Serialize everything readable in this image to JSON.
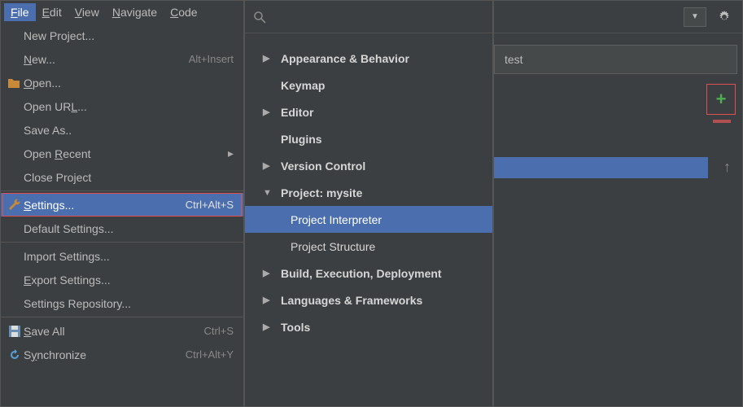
{
  "menubar": {
    "items": [
      {
        "label": "File",
        "u": "F"
      },
      {
        "label": "Edit",
        "u": "E"
      },
      {
        "label": "View",
        "u": "V"
      },
      {
        "label": "Navigate",
        "u": "N"
      },
      {
        "label": "Code",
        "u": "C"
      }
    ]
  },
  "file_menu": {
    "new_project": "New Project...",
    "new": "New...",
    "new_shortcut": "Alt+Insert",
    "open": "Open...",
    "open_url": "Open URL...",
    "save_as": "Save As..",
    "open_recent": "Open Recent",
    "close_project": "Close Project",
    "settings": "Settings...",
    "settings_shortcut": "Ctrl+Alt+S",
    "default_settings": "Default Settings...",
    "import_settings": "Import Settings...",
    "export_settings": "Export Settings...",
    "settings_repository": "Settings Repository...",
    "save_all": "Save All",
    "save_all_shortcut": "Ctrl+S",
    "synchronize": "Synchronize",
    "synchronize_shortcut": "Ctrl+Alt+Y"
  },
  "settings_tree": {
    "appearance": "Appearance & Behavior",
    "keymap": "Keymap",
    "editor": "Editor",
    "plugins": "Plugins",
    "version_control": "Version Control",
    "project": "Project: mysite",
    "project_interpreter": "Project Interpreter",
    "project_structure": "Project Structure",
    "build": "Build, Execution, Deployment",
    "languages": "Languages & Frameworks",
    "tools": "Tools"
  },
  "right": {
    "field_value": "test",
    "search_placeholder": ""
  }
}
